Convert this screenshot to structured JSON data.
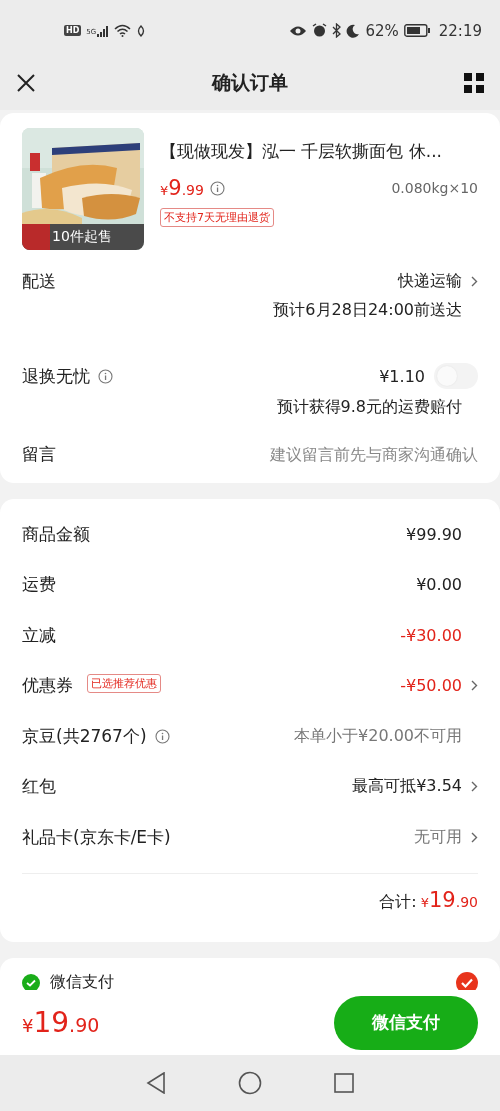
{
  "status_bar": {
    "badges": [
      "HD",
      "5G"
    ],
    "battery_text": "62%",
    "time": "22:19"
  },
  "nav": {
    "title": "确认订单"
  },
  "product": {
    "image_badge": "10件起售",
    "title": "【现做现发】泓一 千层软撕面包 休...",
    "price": {
      "symbol": "¥",
      "integer": "9",
      "decimal": ".99"
    },
    "spec": "0.080kg×10",
    "tag": "不支持7天无理由退货"
  },
  "delivery": {
    "label": "配送",
    "value": "快递运输",
    "estimate": "预计6月28日24:00前送达"
  },
  "return_insurance": {
    "label": "退换无忧",
    "price": "¥1.10",
    "on": false,
    "note": "预计获得9.8元的运费赔付"
  },
  "message": {
    "label": "留言",
    "placeholder": "建议留言前先与商家沟通确认"
  },
  "summary": [
    {
      "label": "商品金额",
      "value": "¥99.90",
      "color": "#222222",
      "info": false,
      "arrow": false
    },
    {
      "label": "运费",
      "value": "¥0.00",
      "color": "#222222",
      "info": false,
      "arrow": false
    },
    {
      "label": "立减",
      "value": "-¥30.00",
      "color": "#e2231a",
      "info": false,
      "arrow": false
    },
    {
      "label": "优惠券",
      "tag": "已选推荐优惠",
      "value": "-¥50.00",
      "color": "#e2231a",
      "info": false,
      "arrow": true
    },
    {
      "label": "京豆(共2767个)",
      "value": "本单小于¥20.00不可用",
      "color": "#777777",
      "info": true,
      "arrow": false
    },
    {
      "label": "红包",
      "value": "最高可抵¥3.54",
      "color": "#222222",
      "info": false,
      "arrow": true
    },
    {
      "label": "礼品卡(京东卡/E卡)",
      "value": "无可用",
      "color": "#777777",
      "info": false,
      "arrow": true
    }
  ],
  "total": {
    "label": "合计:",
    "symbol": "¥",
    "integer": "19",
    "decimal": ".90"
  },
  "payment_method": {
    "label": "微信支付",
    "selected": true
  },
  "bottom_bar": {
    "symbol": "¥",
    "integer": "19",
    "decimal": ".90",
    "button": "微信支付"
  }
}
